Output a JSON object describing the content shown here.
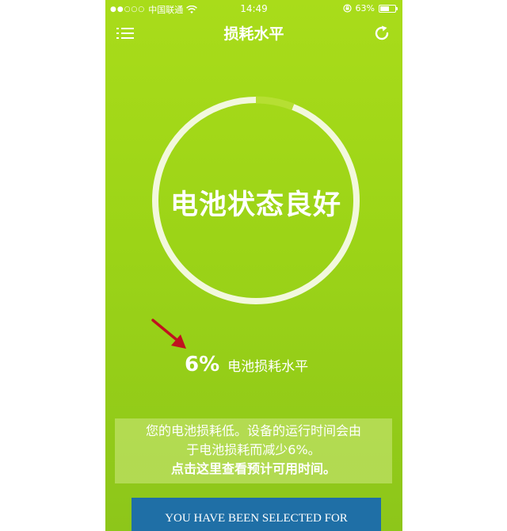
{
  "status_bar": {
    "signal": "●●○○○",
    "carrier": "中国联通",
    "time": "14:49",
    "battery_text": "63%",
    "battery_level": 0.63
  },
  "nav": {
    "title": "损耗水平",
    "menu_icon": "menu-icon",
    "refresh_icon": "refresh-icon"
  },
  "gauge": {
    "status_text": "电池状态良好",
    "wear_fraction": 0.06
  },
  "level": {
    "value": "6%",
    "label": "电池损耗水平"
  },
  "info": {
    "line1": "您的电池损耗低。设备的运行时间会由",
    "line2": "于电池损耗而减少6%。",
    "link": "点击这里查看预计可用时间。"
  },
  "ad": {
    "text": "YOU HAVE BEEN SELECTED FOR"
  },
  "colors": {
    "background": "#9cd417",
    "ring": "#f2f8dd",
    "arrow": "#c0121f",
    "ad_banner": "#1f6fa6"
  }
}
